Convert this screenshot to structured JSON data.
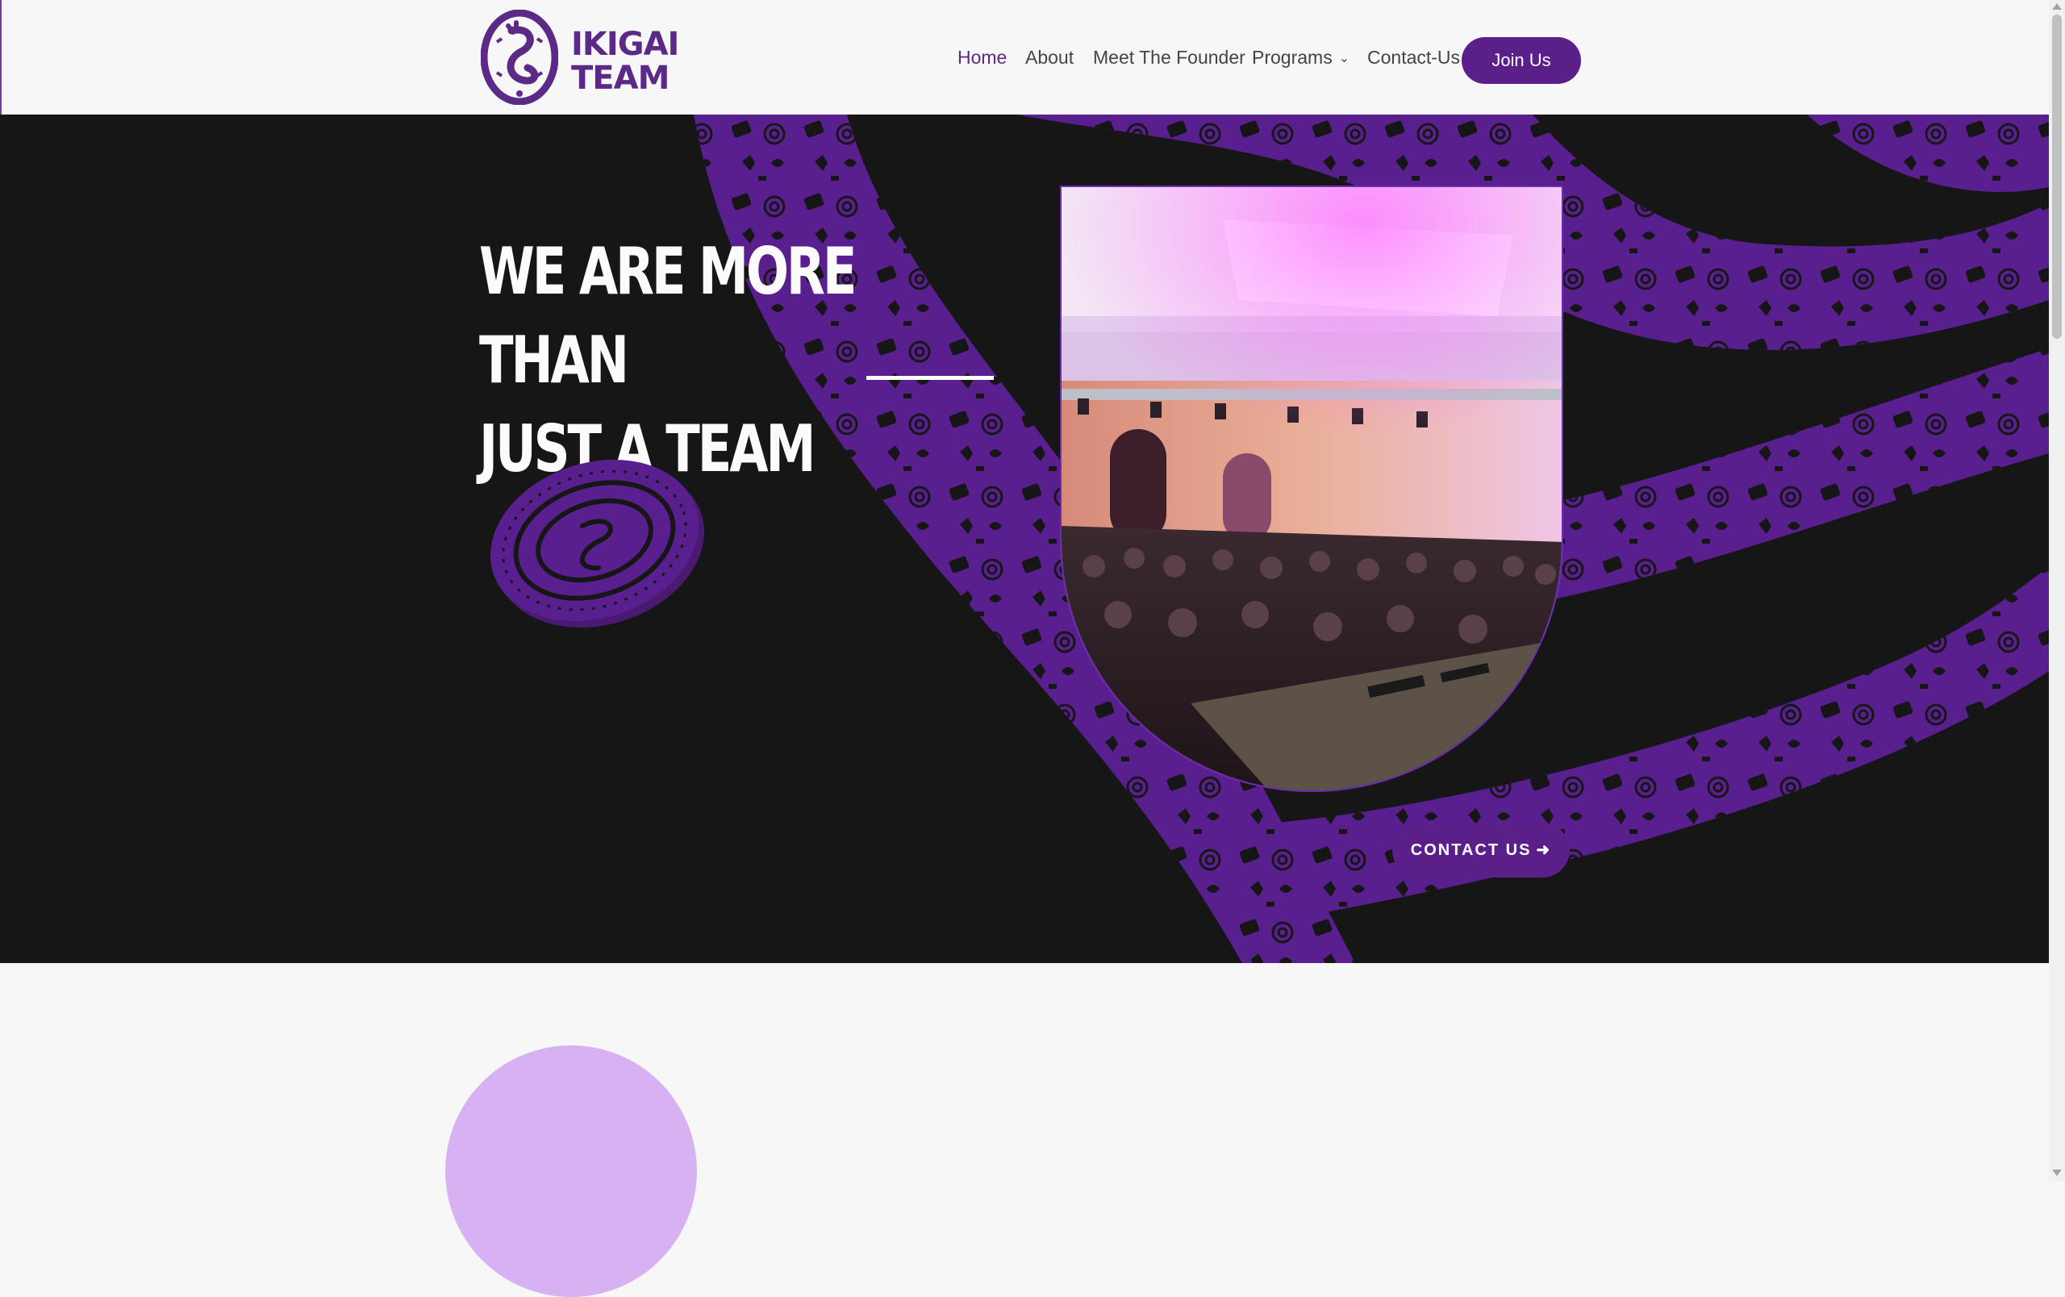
{
  "brand": {
    "name_line1": "IKIGAI",
    "name_line2": "TEAM",
    "color": "#5b2a86"
  },
  "nav": {
    "items": [
      {
        "label": "Home",
        "active": true
      },
      {
        "label": "About"
      },
      {
        "label": "Meet The Founder"
      },
      {
        "label": "Programs",
        "has_dropdown": true
      },
      {
        "label": "Contact-Us"
      }
    ],
    "cta_label": "Join Us"
  },
  "hero": {
    "title_line1": "WE ARE MORE THAN",
    "title_line2": "JUST A TEAM",
    "cta_label": "CONTACT US",
    "cta_icon": "arrow-right-icon",
    "accent_color": "#5b1f8a",
    "pattern_color": "#5a1f8f",
    "background_color": "#161617"
  },
  "lower_section": {
    "blob_color": "#d7b2f3"
  }
}
